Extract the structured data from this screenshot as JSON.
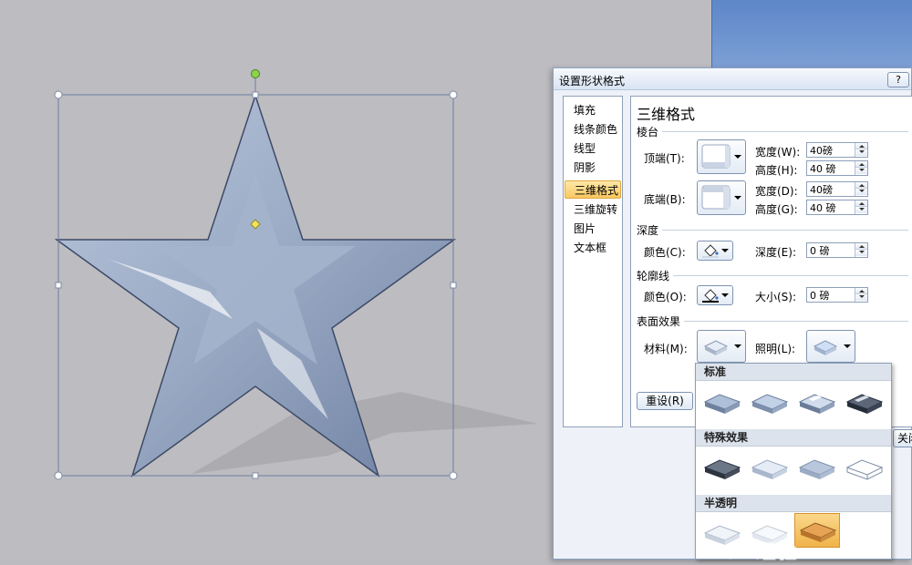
{
  "dialog": {
    "title": "设置形状格式",
    "help_label": "?",
    "categories": [
      {
        "label": "填充"
      },
      {
        "label": "线条颜色"
      },
      {
        "label": "线型"
      },
      {
        "label": "阴影"
      },
      {
        "label": "三维格式",
        "selected": true
      },
      {
        "label": "三维旋转"
      },
      {
        "label": "图片"
      },
      {
        "label": "文本框"
      }
    ],
    "panel": {
      "section_title": "三维格式",
      "bevel": {
        "group_label": "棱台",
        "top_label": "顶端(T):",
        "bottom_label": "底端(B):",
        "top_width_label": "宽度(W):",
        "top_width_value": "40磅",
        "top_height_label": "高度(H):",
        "top_height_value": "40 磅",
        "bottom_width_label": "宽度(D):",
        "bottom_width_value": "40磅",
        "bottom_height_label": "高度(G):",
        "bottom_height_value": "40 磅"
      },
      "depth": {
        "group_label": "深度",
        "color_label": "颜色(C):",
        "depth_label": "深度(E):",
        "depth_value": "0 磅"
      },
      "contour": {
        "group_label": "轮廓线",
        "color_label": "颜色(O):",
        "size_label": "大小(S):",
        "size_value": "0 磅"
      },
      "surface": {
        "group_label": "表面效果",
        "material_label": "材料(M):",
        "lighting_label": "照明(L):"
      },
      "reset_label": "重设(R)"
    },
    "close_label": "关闭"
  },
  "material_gallery": {
    "groups": [
      {
        "label": "标准",
        "count": 4
      },
      {
        "label": "特殊效果",
        "count": 4
      },
      {
        "label": "半透明",
        "count": 3,
        "selected_index": 2
      }
    ]
  },
  "watermark": "Bai 经验",
  "colors": {
    "star_fill": "#9aaac4",
    "selection_highlight": "#f9c761",
    "rotate_handle": "#8bd34a",
    "adjust_handle": "#f1e45a"
  }
}
